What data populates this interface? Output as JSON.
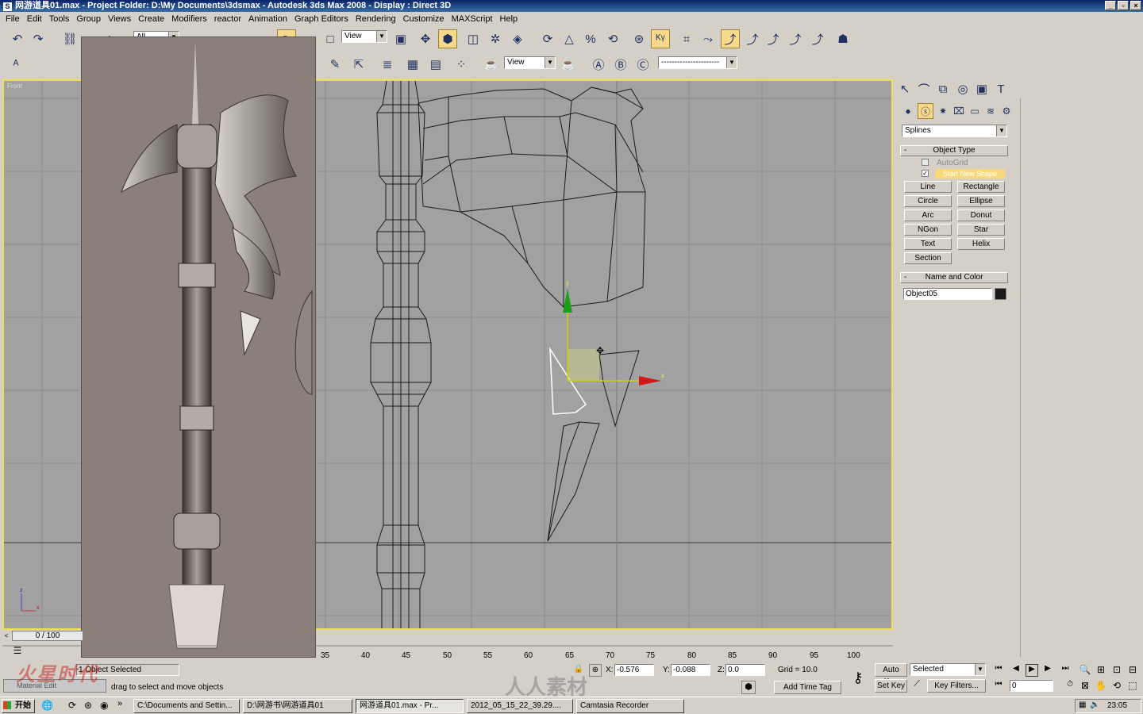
{
  "window": {
    "title": "网游道具01.max    - Project Folder: D:\\My Documents\\3dsmax    - Autodesk 3ds Max 2008    - Display : Direct 3D",
    "minimize": "_",
    "restore": "▫",
    "close": "×"
  },
  "menu": [
    "File",
    "Edit",
    "Tools",
    "Group",
    "Views",
    "Create",
    "Modifiers",
    "reactor",
    "Animation",
    "Graph Editors",
    "Rendering",
    "Customize",
    "MAXScript",
    "Help"
  ],
  "toolbar": {
    "selection_filter": "All",
    "ref_coord": "View",
    "render_view": "View",
    "named_sel": "----------------------"
  },
  "viewport": {
    "label": "Front",
    "axis_y": "y",
    "axis_x": "x",
    "axis_z": "z",
    "accent": "#f0e050",
    "bg": "#a1a1a1"
  },
  "command_panel": {
    "category": "Splines",
    "object_type_title": "Object Type",
    "autogrid": "AutoGrid",
    "start_new_shape": "Start New Shape",
    "buttons": [
      "Line",
      "Rectangle",
      "Circle",
      "Ellipse",
      "Arc",
      "Donut",
      "NGon",
      "Star",
      "Text",
      "Helix",
      "Section"
    ],
    "name_color_title": "Name and Color",
    "object_name": "Object05",
    "minus": "-"
  },
  "timeline": {
    "frame": "0 / 100",
    "ticks": [
      "35",
      "40",
      "45",
      "50",
      "55",
      "60",
      "65",
      "70",
      "75",
      "80",
      "85",
      "90",
      "95",
      "100"
    ]
  },
  "status": {
    "selected": "1 Object Selected",
    "prompt": "drag to select and move objects",
    "x_label": "X:",
    "x": "-0.576",
    "y_label": "Y:",
    "y": "-0.088",
    "z_label": "Z:",
    "z": "0.0",
    "grid": "Grid = 10.0",
    "add_time_tag": "Add Time Tag",
    "auto_key": "Auto Key",
    "set_key": "Set Key",
    "key_mode": "Selected",
    "key_filters": "Key Filters...",
    "frame_field": "0",
    "material": "Material Edit"
  },
  "taskbar": {
    "start": "开始",
    "items": [
      "C:\\Documents and Settin...",
      "D:\\网游书\\网游道具01",
      "网游道具01.max    - Pr...",
      "2012_05_15_22_39.29....",
      "Camtasia Recorder"
    ],
    "clock": "23:05",
    "watermark_left": "火星时代",
    "watermark_right": "人人素材"
  }
}
